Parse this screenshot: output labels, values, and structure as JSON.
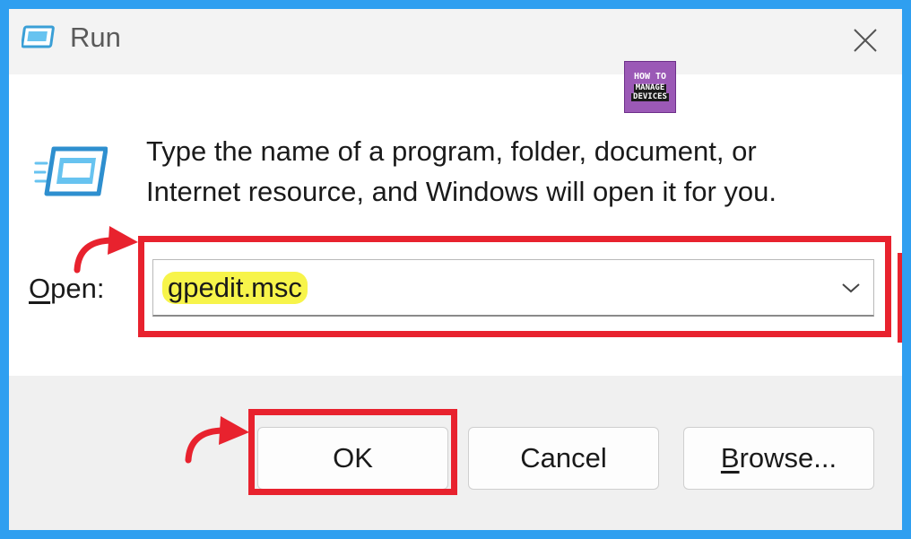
{
  "window": {
    "title": "Run",
    "icon": "run-icon",
    "close_icon": "close-icon"
  },
  "logo": {
    "line1": "HOW TO",
    "line2": "MANAGE",
    "line3": "DEVICES"
  },
  "description": {
    "line1": "Type the name of a program, folder, document, or",
    "line2": "Internet resource, and Windows will open it for you."
  },
  "open_field": {
    "label_accel": "O",
    "label_rest": "pen:",
    "value": "gpedit.msc",
    "dropdown_icon": "chevron-down-icon"
  },
  "buttons": {
    "ok": "OK",
    "cancel": "Cancel",
    "browse_accel": "B",
    "browse_rest": "rowse..."
  },
  "colors": {
    "background": "#2f9ff0",
    "annotation": "#e8222e",
    "highlight": "#f7f44a"
  }
}
